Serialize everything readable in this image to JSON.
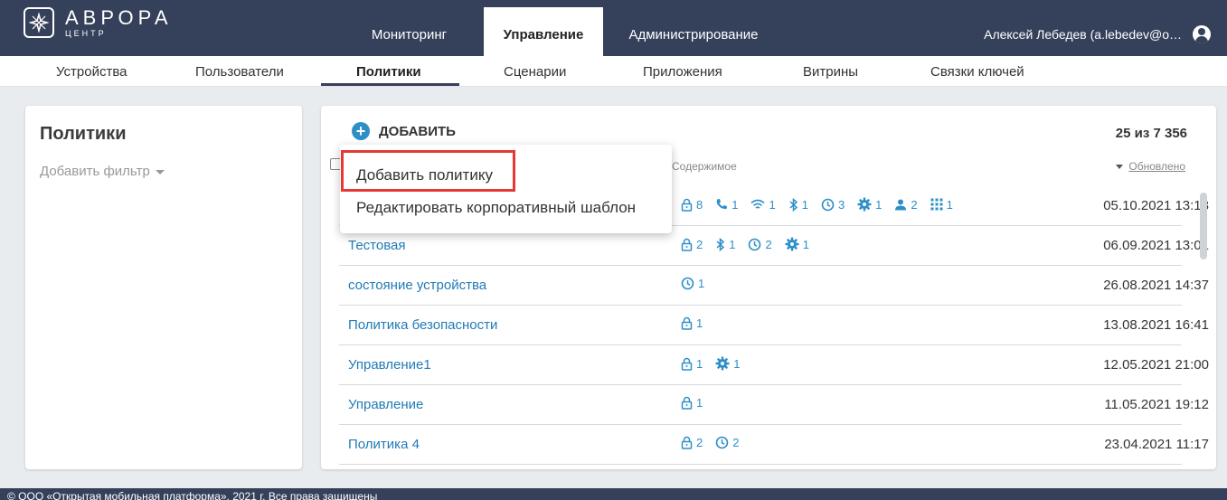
{
  "brand": {
    "name": "АВРОРА",
    "sub": "ЦЕНТР"
  },
  "main_nav": [
    {
      "label": "Мониторинг"
    },
    {
      "label": "Управление"
    },
    {
      "label": "Администрирование"
    }
  ],
  "user": {
    "name": "Алексей Лебедев (a.lebedev@o…",
    "icon": "account-circle-icon"
  },
  "sub_nav": [
    {
      "label": "Устройства"
    },
    {
      "label": "Пользователи"
    },
    {
      "label": "Политики"
    },
    {
      "label": "Сценарии"
    },
    {
      "label": "Приложения"
    },
    {
      "label": "Витрины"
    },
    {
      "label": "Связки ключей"
    }
  ],
  "left_panel": {
    "title": "Политики",
    "filter_label": "Добавить фильтр"
  },
  "toolbar": {
    "add_label": "ДОБАВИТЬ",
    "count": "25 из 7 356"
  },
  "table": {
    "col_content": "Содержимое",
    "col_updated": "Обновлено",
    "rows": [
      {
        "name": "",
        "date": "05.10.2021 13:13",
        "icons": [
          [
            "lock",
            "8"
          ],
          [
            "phone",
            "1"
          ],
          [
            "wifi",
            "1"
          ],
          [
            "bluetooth",
            "1"
          ],
          [
            "clock",
            "3"
          ],
          [
            "gear",
            "1"
          ],
          [
            "user",
            "2"
          ],
          [
            "apps",
            "1"
          ]
        ]
      },
      {
        "name": "Тестовая",
        "date": "06.09.2021 13:01",
        "icons": [
          [
            "lock",
            "2"
          ],
          [
            "bluetooth",
            "1"
          ],
          [
            "clock",
            "2"
          ],
          [
            "gear",
            "1"
          ]
        ]
      },
      {
        "name": "состояние устройства",
        "date": "26.08.2021 14:37",
        "icons": [
          [
            "clock",
            "1"
          ]
        ]
      },
      {
        "name": "Политика безопасности",
        "date": "13.08.2021 16:41",
        "icons": [
          [
            "lock",
            "1"
          ]
        ]
      },
      {
        "name": "Управление1",
        "date": "12.05.2021 21:00",
        "icons": [
          [
            "lock",
            "1"
          ],
          [
            "gear",
            "1"
          ]
        ]
      },
      {
        "name": "Управление",
        "date": "11.05.2021 19:12",
        "icons": [
          [
            "lock",
            "1"
          ]
        ]
      },
      {
        "name": "Политика 4",
        "date": "23.04.2021 11:17",
        "icons": [
          [
            "lock",
            "2"
          ],
          [
            "clock",
            "2"
          ]
        ]
      }
    ]
  },
  "menu": {
    "item1": "Добавить политику",
    "item2": "Редактировать корпоративный шаблон"
  },
  "footer": {
    "text": "© ООО «Открытая мобильная платформа», 2021 г. Все права защищены"
  },
  "colors": {
    "header_bg": "#35405a",
    "accent": "#2e8fc7",
    "link": "#1f7bb6",
    "highlight": "#e53935"
  }
}
